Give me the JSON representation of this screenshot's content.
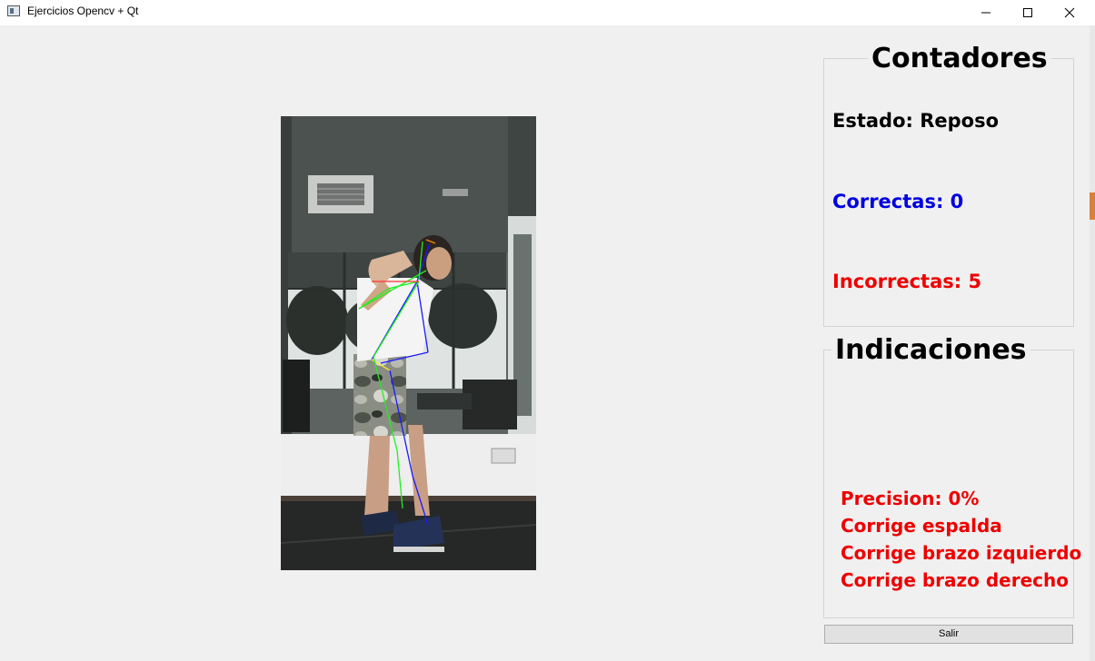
{
  "window": {
    "title": "Ejercicios Opencv + Qt",
    "controls": [
      "minimize-icon",
      "maximize-icon",
      "close-icon"
    ]
  },
  "counters": {
    "title": "Contadores",
    "estado": "Estado: Reposo",
    "correctas": "Correctas: 0",
    "incorrectas": "Incorrectas: 5"
  },
  "indications": {
    "title": "Indicaciones",
    "precision": "Precision: 0%",
    "feedback": [
      "Corrige espalda",
      "Corrige brazo izquierdo",
      "Corrige brazo derecho"
    ]
  },
  "buttons": {
    "exit": "Salir"
  },
  "colors": {
    "correct": "#0000e0",
    "incorrect": "#ee0000",
    "background": "#f0f0f0",
    "skeleton_left": "#22ee22",
    "skeleton_right": "#1a1aff"
  }
}
